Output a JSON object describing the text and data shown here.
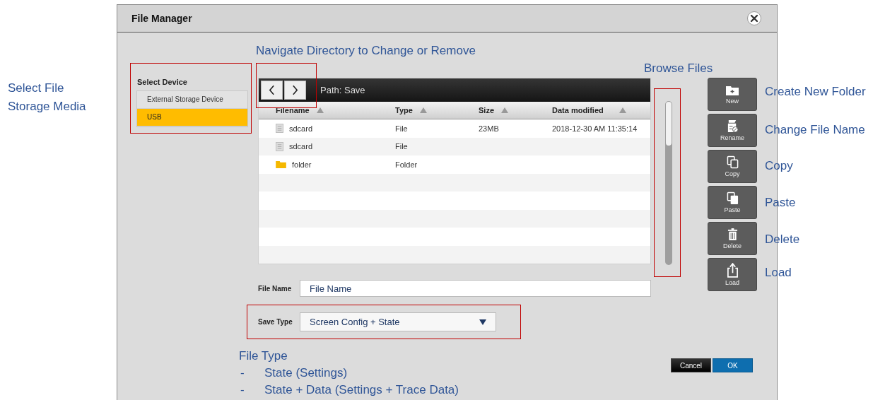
{
  "window": {
    "title": "File Manager"
  },
  "device_panel": {
    "label": "Select Device",
    "devices": [
      {
        "label": "External Storage Device",
        "selected": false
      },
      {
        "label": "USB",
        "selected": true
      }
    ]
  },
  "browser": {
    "path": "Path: Save",
    "columns": [
      "Filename",
      "Type",
      "Size",
      "Data modified"
    ],
    "rows": [
      {
        "kind": "file",
        "name": "sdcard",
        "type": "File",
        "size": "23MB",
        "modified": "2018-12-30 AM 11:35:14"
      },
      {
        "kind": "file",
        "name": "sdcard",
        "type": "File"
      },
      {
        "kind": "folder",
        "name": "folder",
        "type": "Folder"
      }
    ]
  },
  "file_name": {
    "label": "File Name",
    "value": "File Name"
  },
  "save_type": {
    "label": "Save Type",
    "value": "Screen Config + State"
  },
  "tools": [
    {
      "kind": "new",
      "label": "New"
    },
    {
      "kind": "rename",
      "label": "Rename"
    },
    {
      "kind": "copy",
      "label": "Copy"
    },
    {
      "kind": "paste",
      "label": "Paste"
    },
    {
      "kind": "delete",
      "label": "Delete"
    },
    {
      "kind": "load",
      "label": "Load"
    }
  ],
  "buttons": [
    {
      "kind": "cancel",
      "label": "Cancel"
    },
    {
      "kind": "ok",
      "label": "OK"
    }
  ],
  "annotations": {
    "device": "Select File Storage Media",
    "navigate": "Navigate Directory to Change or Remove",
    "browse": "Browse Files",
    "tools": [
      "Create New Folder",
      "Change File Name",
      "Copy",
      "Paste",
      "Delete",
      "Load"
    ],
    "file_type": {
      "title": "File Type",
      "items": [
        {
          "bullet": "-",
          "text": "State (Settings)"
        },
        {
          "bullet": "-",
          "text": "State + Data (Settings + Trace Data)"
        }
      ]
    }
  }
}
